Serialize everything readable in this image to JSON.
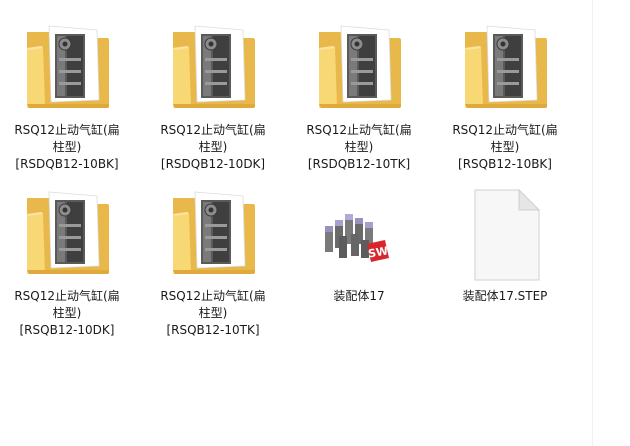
{
  "items": [
    {
      "label": "RSQ12止动气缸(扁\n柱型)\n[RSDQB12-10BK]",
      "icon": "folder-icon"
    },
    {
      "label": "RSQ12止动气缸(扁\n柱型)\n[RSDQB12-10DK]",
      "icon": "folder-icon"
    },
    {
      "label": "RSQ12止动气缸(扁\n柱型)\n[RSDQB12-10TK]",
      "icon": "folder-icon"
    },
    {
      "label": "RSQ12止动气缸(扁\n柱型)\n[RSQB12-10BK]",
      "icon": "folder-icon"
    },
    {
      "label": "RSQ12止动气缸(扁\n柱型)\n[RSQB12-10DK]",
      "icon": "folder-icon"
    },
    {
      "label": "RSQ12止动气缸(扁\n柱型)\n[RSQB12-10TK]",
      "icon": "folder-icon"
    },
    {
      "label": "装配体17",
      "icon": "solidworks-assembly-icon"
    },
    {
      "label": "装配体17.STEP",
      "icon": "blank-document-icon"
    }
  ],
  "colors": {
    "folder_back": "#e8b84a",
    "folder_front": "#f8d775",
    "paper": "#f7f7f7",
    "cylinder": "#5a5a5a",
    "solidworks_red": "#d9262c"
  }
}
